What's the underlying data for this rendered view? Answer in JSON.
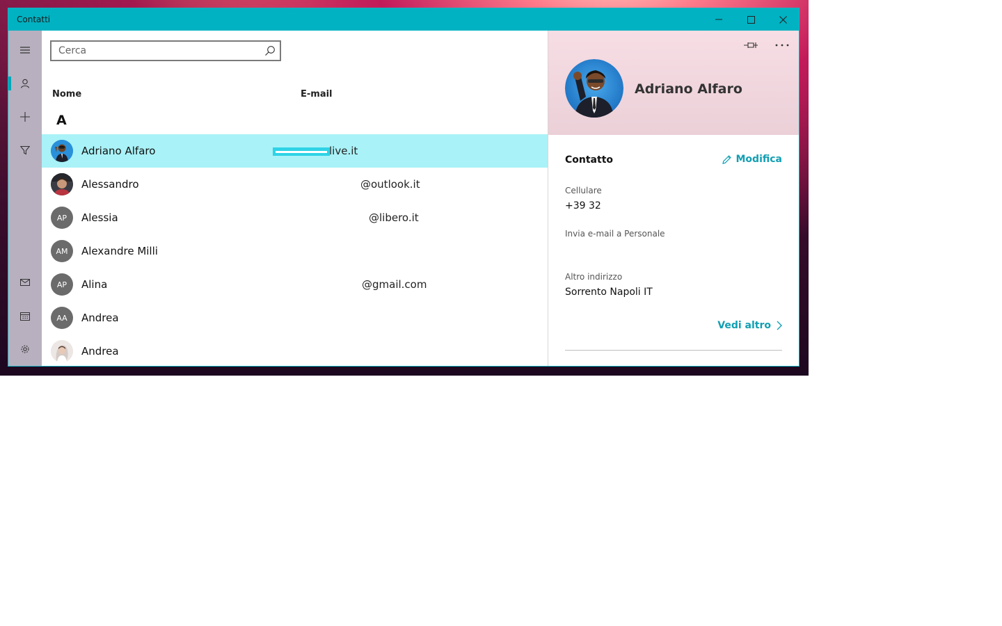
{
  "window": {
    "title": "Contatti"
  },
  "search": {
    "placeholder": "Cerca"
  },
  "columns": {
    "name": "Nome",
    "email": "E-mail"
  },
  "group_letter": "A",
  "contacts": [
    {
      "name": "Adriano Alfaro",
      "email": "live.it",
      "avatar": "photo",
      "initials": ""
    },
    {
      "name": "Alessandro",
      "email": "@outlook.it",
      "avatar": "photo",
      "initials": ""
    },
    {
      "name": "Alessia",
      "email": "@libero.it",
      "avatar": "initials",
      "initials": "AP"
    },
    {
      "name": "Alexandre Milli",
      "email": "",
      "avatar": "initials",
      "initials": "AM"
    },
    {
      "name": "Alina",
      "email": "@gmail.com",
      "avatar": "initials",
      "initials": "AP"
    },
    {
      "name": "Andrea",
      "email": "",
      "avatar": "initials",
      "initials": "AA"
    },
    {
      "name": "Andrea",
      "email": "",
      "avatar": "photo",
      "initials": ""
    }
  ],
  "detail": {
    "name": "Adriano Alfaro",
    "section_title": "Contatto",
    "edit_label": "Modifica",
    "mobile_label": "Cellulare",
    "mobile_value": "+39 32",
    "email_label": "Invia e-mail a Personale",
    "address_label": "Altro indirizzo",
    "address_value": "Sorrento Napoli IT",
    "more_label": "Vedi altro"
  },
  "nav_icons": [
    "hamburger-icon",
    "person-icon",
    "plus-icon",
    "filter-icon",
    "mail-icon",
    "calendar-icon",
    "gear-icon"
  ],
  "colors": {
    "accent": "#00b2c2",
    "selected_row": "#a9f2f7",
    "link": "#119fb3"
  }
}
